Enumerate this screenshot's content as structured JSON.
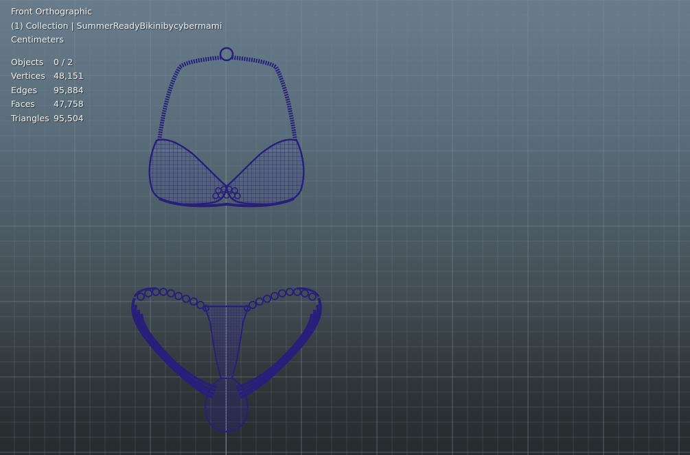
{
  "viewport": {
    "view_name": "Front Orthographic",
    "collection_line": "(1) Collection | SummerReadyBikinibycybermami",
    "units": "Centimeters"
  },
  "stats": [
    {
      "label": "Objects",
      "value": "0 / 2"
    },
    {
      "label": "Vertices",
      "value": "48,151"
    },
    {
      "label": "Edges",
      "value": "95,884"
    },
    {
      "label": "Faces",
      "value": "47,758"
    },
    {
      "label": "Triangles",
      "value": "95,504"
    }
  ],
  "colors": {
    "wireframe": "#26207a",
    "axis_z": "#3f8fb3",
    "grid_minor": "#6f8594",
    "grid_major": "#7b909e"
  }
}
